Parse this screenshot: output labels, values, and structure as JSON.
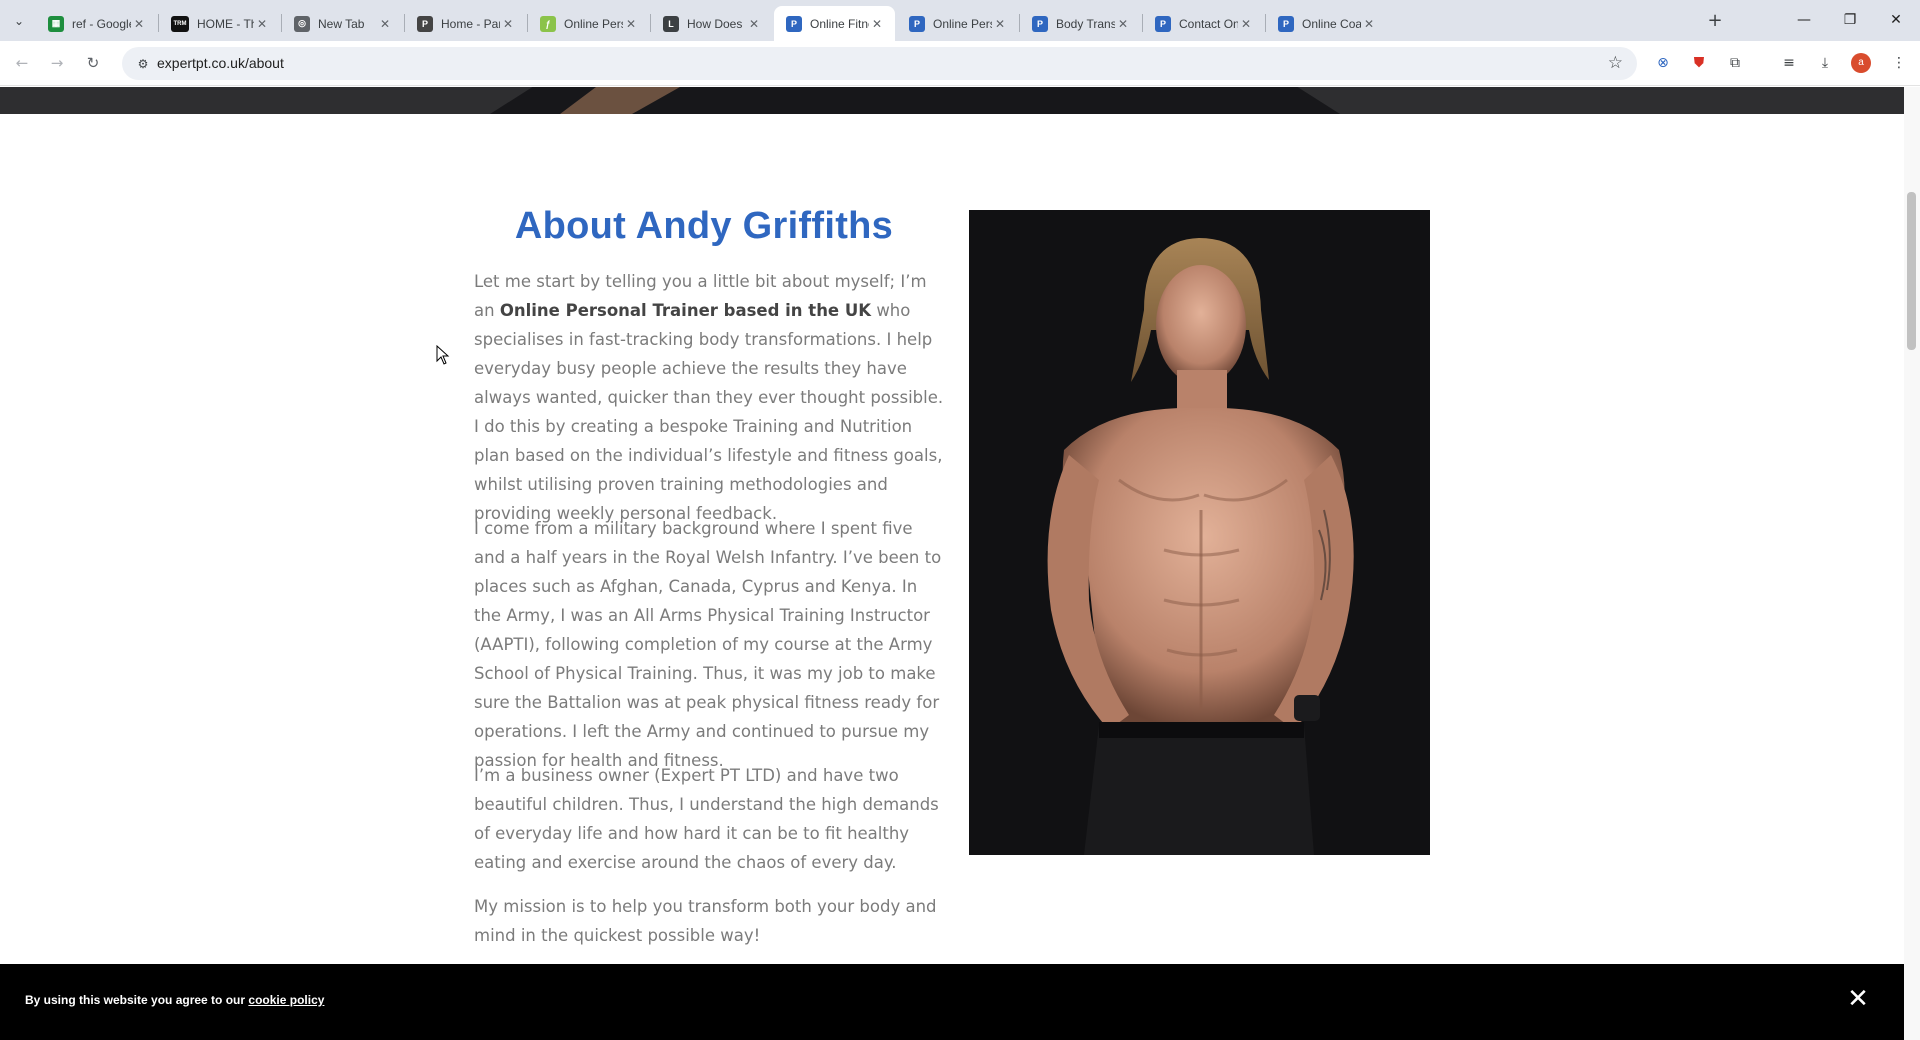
{
  "browser": {
    "tabs": [
      {
        "title": "ref - Google Sh",
        "favicon": "google-sheets-icon",
        "color": "#1e8e3e",
        "glyph": "▦"
      },
      {
        "title": "HOME - The R",
        "favicon": "trm-logo-icon",
        "color": "#111111",
        "glyph": "TRM"
      },
      {
        "title": "New Tab",
        "favicon": "chrome-icon",
        "color": "#5f6368",
        "glyph": "◎"
      },
      {
        "title": "Home - Parker",
        "favicon": "parker-logo-icon",
        "color": "#444444",
        "glyph": "P"
      },
      {
        "title": "Online Persona",
        "favicon": "leaf-icon",
        "color": "#8bc34a",
        "glyph": "ƒ"
      },
      {
        "title": "How Does Onli",
        "favicon": "l-logo-icon",
        "color": "#3c4043",
        "glyph": "L"
      },
      {
        "title": "Online Fitness",
        "favicon": "expertpt-icon",
        "color": "#2f67c0",
        "glyph": "P"
      },
      {
        "title": "Online Persona",
        "favicon": "expertpt-icon",
        "color": "#2f67c0",
        "glyph": "P"
      },
      {
        "title": "Body Transform",
        "favicon": "expertpt-icon",
        "color": "#2f67c0",
        "glyph": "P"
      },
      {
        "title": "Contact Online",
        "favicon": "expertpt-icon",
        "color": "#2f67c0",
        "glyph": "P"
      },
      {
        "title": "Online Coachin",
        "favicon": "expertpt-icon",
        "color": "#2f67c0",
        "glyph": "P"
      }
    ],
    "active_tab_index": 6,
    "url": "expertpt.co.uk/about",
    "profile_initial": "a"
  },
  "page": {
    "title": "About Andy Griffiths",
    "paragraphs": {
      "p1_pre": "Let me start by telling you a little bit about myself; I’m an",
      "p1_bold": "Online Personal Trainer based in the UK",
      "p1_post": "who specialises in fast-tracking body transformations. I help everyday busy people achieve the results they have always wanted, quicker than they ever thought possible. I do this by creating a bespoke Training and Nutrition plan based on the individual’s lifestyle and fitness goals, whilst utilising proven training methodologies and providing weekly personal feedback.",
      "p2": "I come from a military background where I spent five and a half years in the Royal Welsh Infantry. I’ve been to places such as Afghan, Canada, Cyprus and Kenya. In the Army, I was an All Arms Physical Training Instructor (AAPTI), following completion of my course at the Army School of Physical Training. Thus, it was my job to make sure the Battalion was at peak physical fitness ready for operations. I left the Army and continued to pursue my passion for health and fitness.",
      "p3": "I’m a business owner (Expert PT LTD) and have two beautiful children. Thus, I understand the high demands of everyday life and how hard it can be to fit healthy eating and exercise around the chaos of every day.",
      "p4": "My mission is to help you transform both your body and mind in the quickest possible way!"
    }
  },
  "cookie": {
    "text": "By using this website you agree to our",
    "link": "cookie policy",
    "close_glyph": "✕"
  },
  "colors": {
    "accent": "#2f67c0",
    "body_text": "#7b7b7b",
    "cookie_bg": "#000000"
  }
}
